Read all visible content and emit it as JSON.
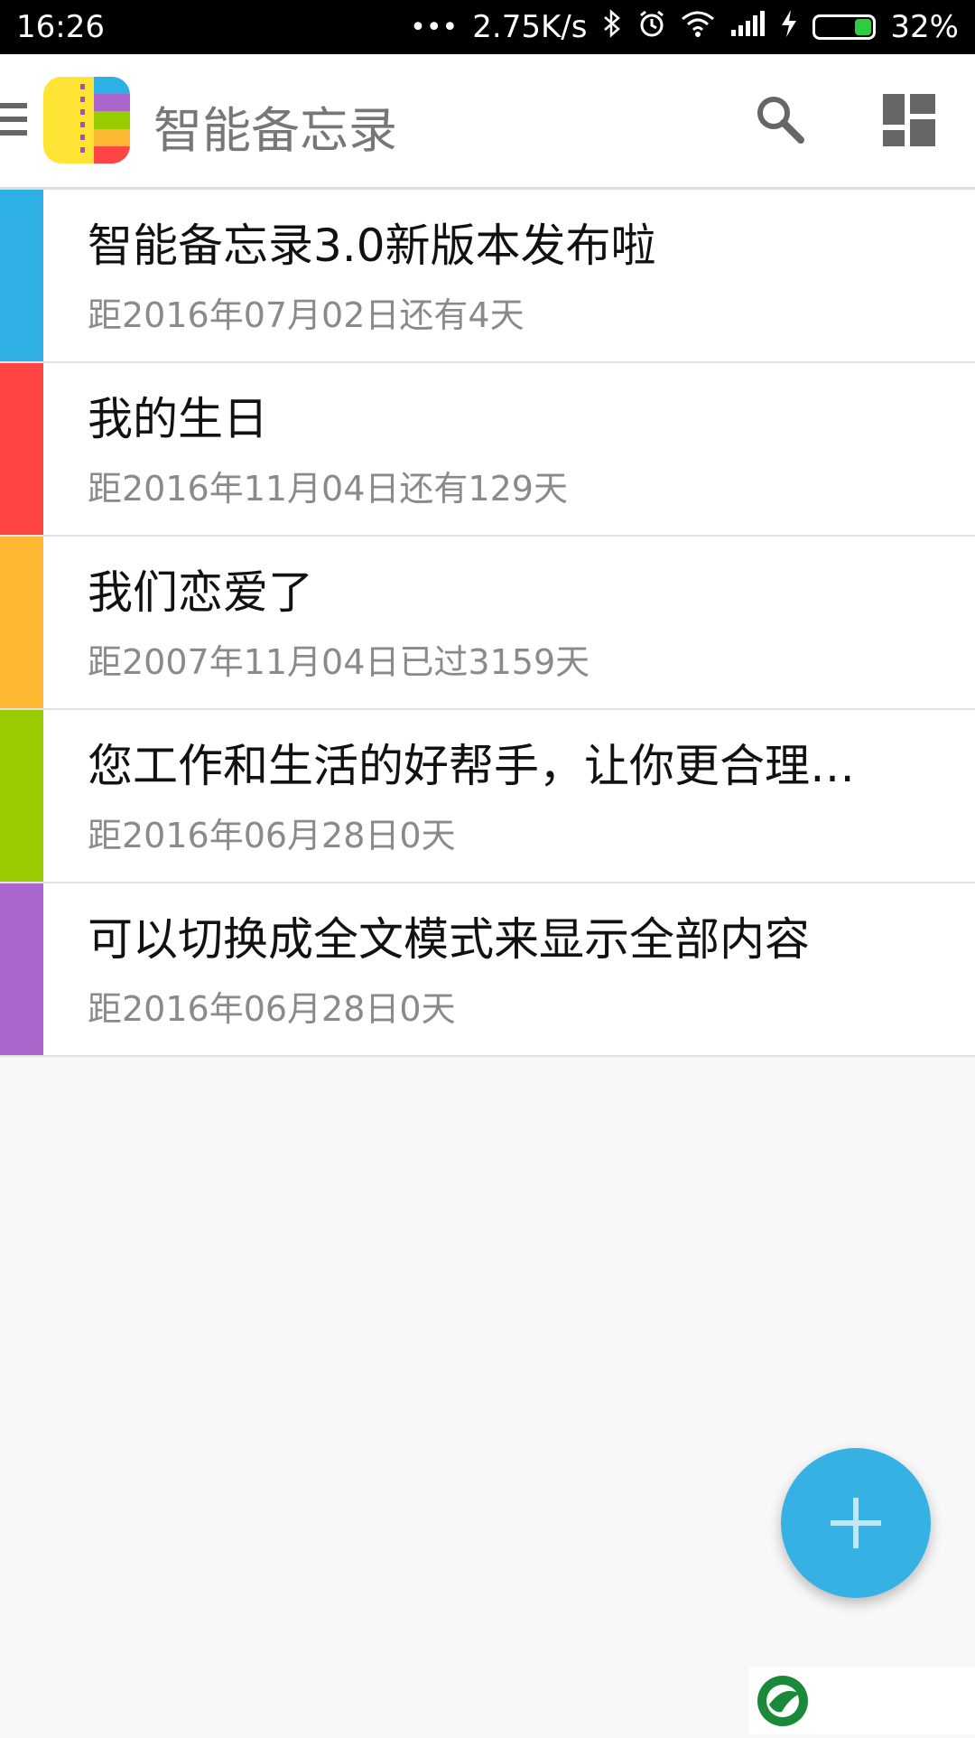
{
  "status_bar": {
    "time": "16:26",
    "dots": "•••",
    "net_speed": "2.75K/s",
    "bluetooth_icon": "bluetooth-icon",
    "alarm_icon": "alarm-icon",
    "wifi_icon": "wifi-icon",
    "signal_icon": "signal-icon",
    "charging_icon": "charging-icon",
    "battery_percent": "32%",
    "battery_level": 0.32
  },
  "app_bar": {
    "title": "智能备忘录",
    "menu_icon": "hamburger-menu-icon",
    "logo_icon": "app-logo-icon",
    "search_icon": "search-icon",
    "layout_icon": "dashboard-layout-icon"
  },
  "colors": {
    "fab": "#35b1e3",
    "blue": "#2eb0e5",
    "red": "#ff4444",
    "orange": "#ffb833",
    "green": "#99cc00",
    "purple": "#aa66cc"
  },
  "items": [
    {
      "title": "智能备忘录3.0新版本发布啦",
      "subtitle": "距2016年07月02日还有4天",
      "color": "#2eb0e5"
    },
    {
      "title": "我的生日",
      "subtitle": "距2016年11月04日还有129天",
      "color": "#ff4444"
    },
    {
      "title": "我们恋爱了",
      "subtitle": "距2007年11月04日已过3159天",
      "color": "#ffb833"
    },
    {
      "title": "您工作和生活的好帮手，让你更合理…",
      "subtitle": "距2016年06月28日0天",
      "color": "#99cc00"
    },
    {
      "title": "可以切换成全文模式来显示全部内容",
      "subtitle": "距2016年06月28日0天",
      "color": "#aa66cc"
    }
  ],
  "fab": {
    "icon": "plus-icon"
  },
  "ad": {
    "icon": "ad-logo-icon"
  }
}
